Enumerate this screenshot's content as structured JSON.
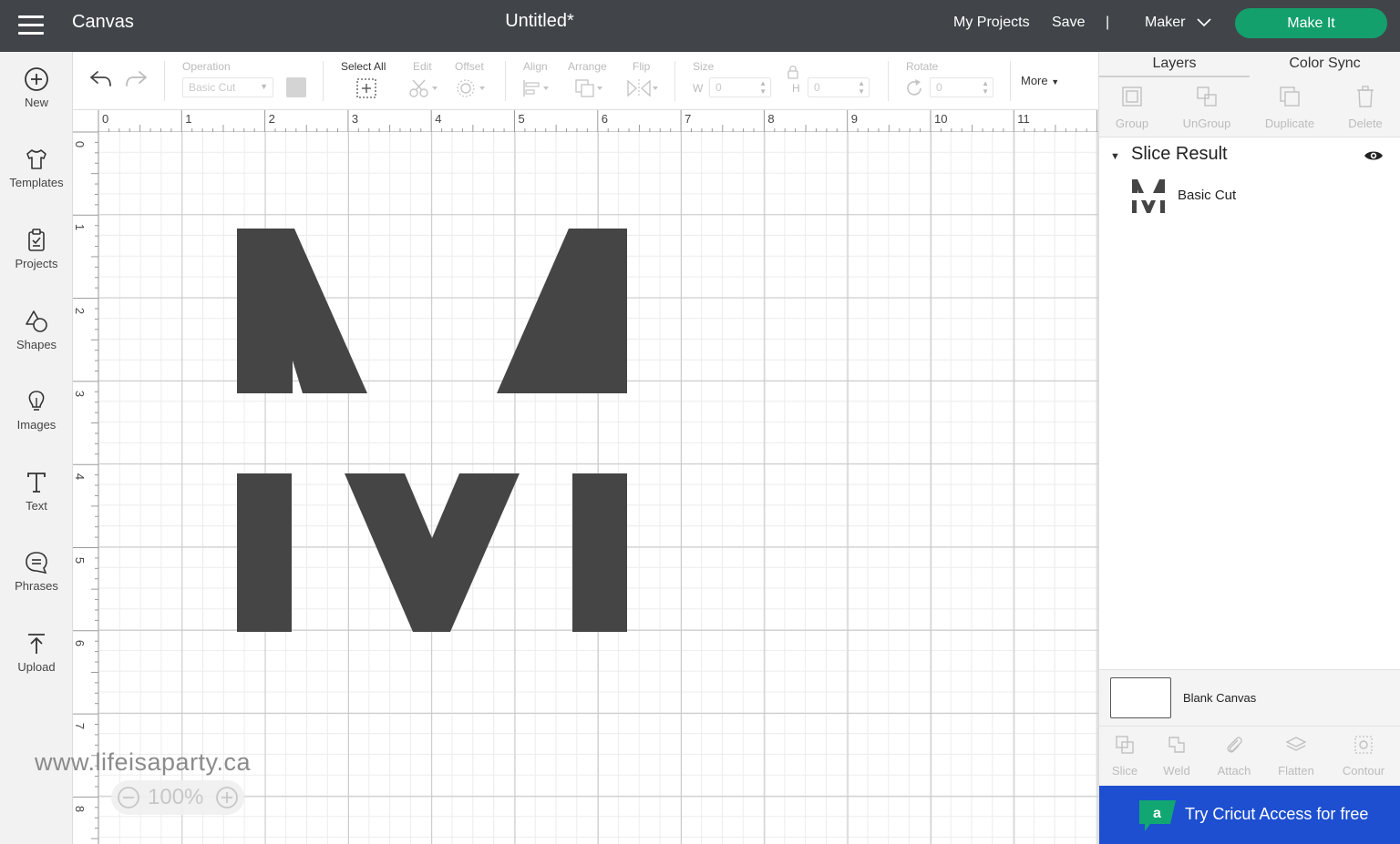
{
  "topbar": {
    "app_title": "Canvas",
    "doc_title": "Untitled*",
    "my_projects": "My Projects",
    "save": "Save",
    "divider": "|",
    "machine": "Maker",
    "make_it": "Make It"
  },
  "sidebar": {
    "items": [
      {
        "label": "New",
        "icon": "plus-circle-icon"
      },
      {
        "label": "Templates",
        "icon": "shirt-icon"
      },
      {
        "label": "Projects",
        "icon": "clipboard-icon"
      },
      {
        "label": "Shapes",
        "icon": "shapes-icon"
      },
      {
        "label": "Images",
        "icon": "lightbulb-icon"
      },
      {
        "label": "Text",
        "icon": "text-icon"
      },
      {
        "label": "Phrases",
        "icon": "speech-bubble-icon"
      },
      {
        "label": "Upload",
        "icon": "upload-icon"
      }
    ]
  },
  "toolbar": {
    "operation_label": "Operation",
    "operation_value": "Basic Cut",
    "select_all": "Select All",
    "edit": "Edit",
    "offset": "Offset",
    "align": "Align",
    "arrange": "Arrange",
    "flip": "Flip",
    "size": "Size",
    "w_label": "W",
    "w_value": "0",
    "h_label": "H",
    "h_value": "0",
    "rotate": "Rotate",
    "rotate_value": "0",
    "more": "More"
  },
  "rulers": {
    "top": [
      "0",
      "1",
      "2",
      "3",
      "4",
      "5",
      "6",
      "7",
      "8",
      "9",
      "10",
      "11"
    ],
    "left": [
      "0",
      "1",
      "2",
      "3",
      "4",
      "5",
      "6",
      "7",
      "8"
    ]
  },
  "canvas": {
    "watermark": "www.lifeisaparty.ca",
    "zoom": "100%",
    "shape_color": "#454545"
  },
  "panel": {
    "tabs": [
      "Layers",
      "Color Sync"
    ],
    "top_actions": [
      "Group",
      "UnGroup",
      "Duplicate",
      "Delete"
    ],
    "group_title": "Slice Result",
    "layer_name": "Basic Cut",
    "blank_canvas": "Blank Canvas",
    "bottom_actions": [
      "Slice",
      "Weld",
      "Attach",
      "Flatten",
      "Contour"
    ],
    "access_banner": "Try Cricut Access for free"
  },
  "colors": {
    "topbar": "#414549",
    "make_it": "#14a06d",
    "banner": "#1d4fd0"
  }
}
